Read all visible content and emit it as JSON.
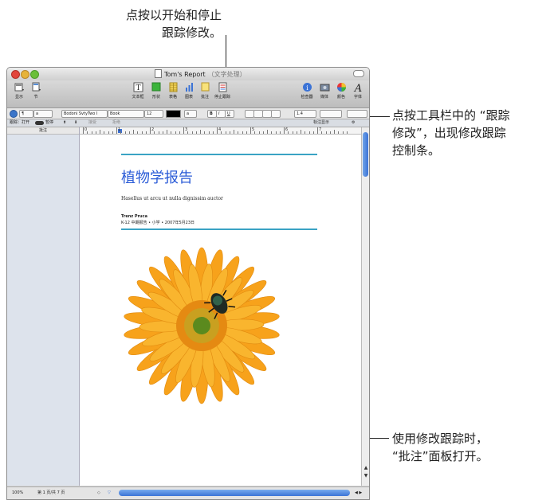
{
  "callouts": {
    "top_line1": "点按以开始和停止",
    "top_line2": "跟踪修改。",
    "right_line1": "点按工具栏中的 “跟踪",
    "right_line2": "修改”，出现修改跟踪",
    "right_line3": "控制条。",
    "bottom_line1": "使用修改跟踪时，",
    "bottom_line2": "“批注”面板打开。"
  },
  "window": {
    "title": "Tom's Report",
    "subtitle": "（文字处理）"
  },
  "toolbar": {
    "view_label": "显示",
    "sections_label": "节",
    "textbox_label": "文本框",
    "shapes_label": "形状",
    "tables_label": "表格",
    "charts_label": "图表",
    "comments_label": "批注",
    "stop_tracking_label": "停止跟踪",
    "inspector_label": "检查器",
    "media_label": "媒体",
    "colors_label": "颜色",
    "fonts_label": "字体"
  },
  "formatbar": {
    "style_a": "¶",
    "style_b": "a",
    "font_family": "Bodoni SvtyTwo I",
    "font_style": "Book",
    "font_size": "12",
    "text_color_label": "a",
    "bold": "B",
    "italic": "I",
    "underline": "U",
    "line_spacing": "1.4"
  },
  "trackbar": {
    "tracking_label": "跟踪：打开",
    "pause_label": "暂停",
    "accept_label": "接受",
    "reject_label": "拒绝",
    "show_markup_label": "标注显示"
  },
  "comments_panel": {
    "header": "批注"
  },
  "ruler": {
    "numbers": [
      "0",
      "1",
      "2",
      "3",
      "4",
      "5",
      "6",
      "7"
    ]
  },
  "document": {
    "title": "植物学报告",
    "subtitle": "Hasellus ut arcu ut nulla dignissim auctor",
    "author": "Trenz Pruca",
    "meta": "K-12 中期报告 • 小学 • 2007年5月23日"
  },
  "statusbar": {
    "zoom": "100%",
    "page": "第 1 页/共 7 页"
  },
  "colors": {
    "title_blue": "#2a5bd7",
    "rule_teal": "#3aa3c4",
    "petal_orange": "#f7a21b"
  }
}
